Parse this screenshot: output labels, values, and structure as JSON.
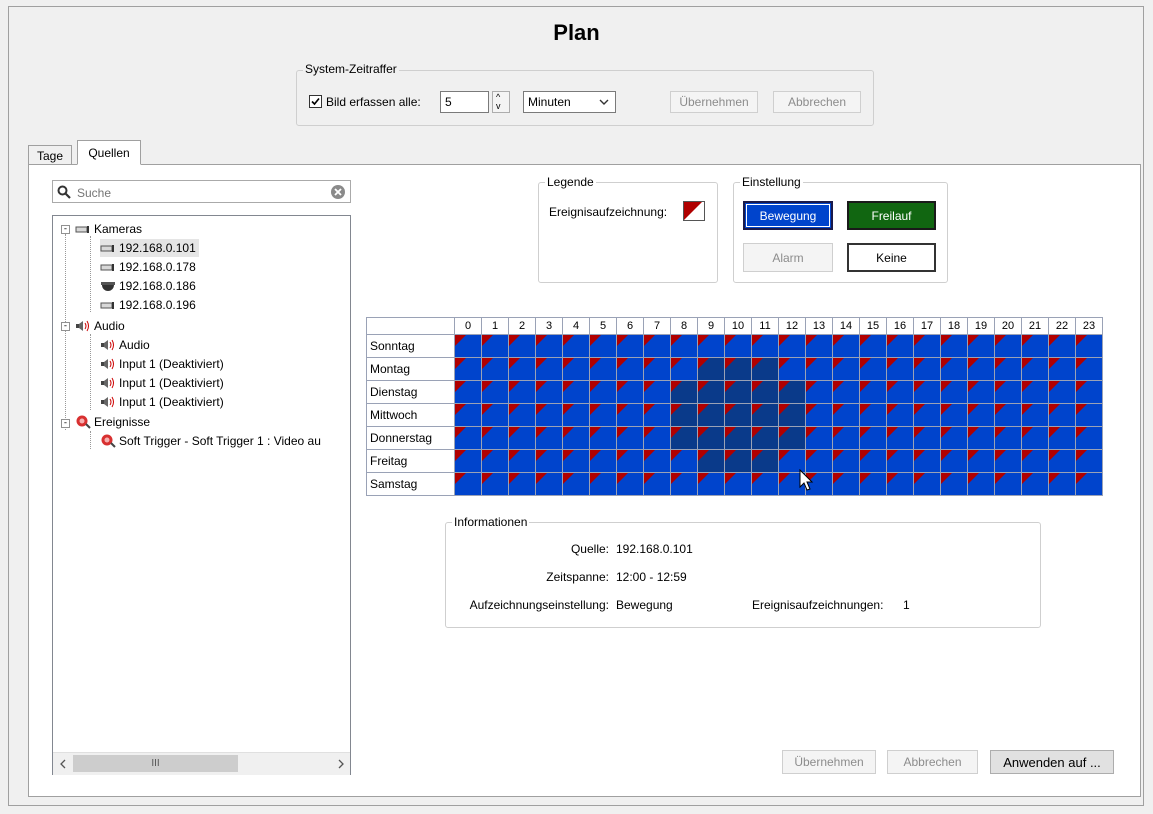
{
  "title": "Plan",
  "system_timelapse": {
    "group_label": "System-Zeitraffer",
    "capture_label": "Bild erfassen alle:",
    "capture_checked": true,
    "interval_value": "5",
    "unit_selected": "Minuten",
    "apply_label": "Übernehmen",
    "cancel_label": "Abbrechen"
  },
  "tabs": [
    {
      "label": "Tage",
      "active": false
    },
    {
      "label": "Quellen",
      "active": true
    }
  ],
  "search": {
    "placeholder": "Suche"
  },
  "tree": {
    "cameras_label": "Kameras",
    "cameras": [
      "192.168.0.101",
      "192.168.0.178",
      "192.168.0.186",
      "192.168.0.196"
    ],
    "audio_label": "Audio",
    "audio": [
      "Audio",
      "Input 1 (Deaktiviert)",
      "Input 1 (Deaktiviert)",
      "Input 1 (Deaktiviert)"
    ],
    "events_label": "Ereignisse",
    "events": [
      "Soft Trigger - Soft Trigger 1 : Video au"
    ]
  },
  "legend": {
    "group_label": "Legende",
    "event_recording_label": "Ereignisaufzeichnung:"
  },
  "setting": {
    "group_label": "Einstellung",
    "motion_label": "Bewegung",
    "freerun_label": "Freilauf",
    "alarm_label": "Alarm",
    "none_label": "Keine",
    "motion_color": "#0044cc",
    "freerun_color": "#116611"
  },
  "schedule": {
    "hours": [
      "0",
      "1",
      "2",
      "3",
      "4",
      "5",
      "6",
      "7",
      "8",
      "9",
      "10",
      "11",
      "12",
      "13",
      "14",
      "15",
      "16",
      "17",
      "18",
      "19",
      "20",
      "21",
      "22",
      "23"
    ],
    "days": [
      "Sonntag",
      "Montag",
      "Dienstag",
      "Mittwoch",
      "Donnerstag",
      "Freitag",
      "Samstag"
    ]
  },
  "info": {
    "group_label": "Informationen",
    "source_label": "Quelle:",
    "source_value": "192.168.0.101",
    "timespan_label": "Zeitspanne:",
    "timespan_value": "12:00 - 12:59",
    "recording_setting_label": "Aufzeichnungseinstellung:",
    "recording_setting_value": "Bewegung",
    "event_records_label": "Ereignisaufzeichnungen:",
    "event_records_value": "1"
  },
  "footer": {
    "apply_label": "Übernehmen",
    "cancel_label": "Abbrechen",
    "apply_to_label": "Anwenden auf ..."
  },
  "scrollbar": {
    "thumb_glyph": "III"
  }
}
